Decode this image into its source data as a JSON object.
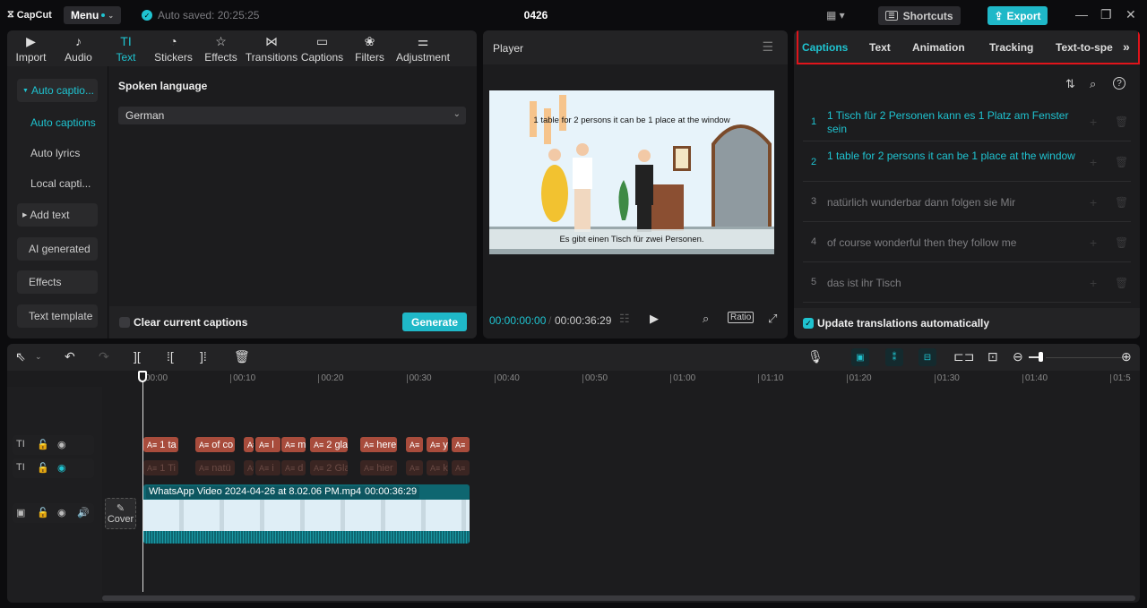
{
  "titlebar": {
    "app_name": "CapCut",
    "menu_label": "Menu",
    "autosave_text": "Auto saved: 20:25:25",
    "project_title": "0426",
    "shortcuts_label": "Shortcuts",
    "export_label": "Export",
    "icons": {
      "layout": "layout-icon",
      "minimize": "minimize-icon",
      "maximize": "restore-icon",
      "close": "close-icon"
    }
  },
  "media_toolbar": [
    {
      "label": "Import",
      "icon": "▶"
    },
    {
      "label": "Audio",
      "icon": "♪"
    },
    {
      "label": "Text",
      "icon": "TI",
      "active": true
    },
    {
      "label": "Stickers",
      "icon": "◔"
    },
    {
      "label": "Effects",
      "icon": "☆"
    },
    {
      "label": "Transitions",
      "icon": "⋈"
    },
    {
      "label": "Captions",
      "icon": "▭"
    },
    {
      "label": "Filters",
      "icon": "❀"
    },
    {
      "label": "Adjustment",
      "icon": "⚌"
    }
  ],
  "text_sidebar": {
    "items": [
      {
        "label": "Auto captio...",
        "expanded": true
      },
      {
        "label": "Auto captions",
        "active": true
      },
      {
        "label": "Auto lyrics"
      },
      {
        "label": "Local capti..."
      },
      {
        "label": "Add text"
      },
      {
        "label": "AI generated"
      },
      {
        "label": "Effects"
      },
      {
        "label": "Text template"
      }
    ]
  },
  "auto_captions": {
    "spoken_language_label": "Spoken language",
    "language_value": "German",
    "clear_captions_label": "Clear current captions",
    "clear_captions_checked": false,
    "generate_label": "Generate"
  },
  "player": {
    "title": "Player",
    "video_top_caption": "1 table for 2 persons it can be 1 place at the window",
    "video_bottom_caption": "Es gibt einen Tisch für zwei Personen.",
    "current_time": "00:00:00:00",
    "total_time": "00:00:36:29",
    "ratio_label": "Ratio"
  },
  "right_panel": {
    "tabs": [
      {
        "label": "Captions",
        "active": true
      },
      {
        "label": "Text"
      },
      {
        "label": "Animation"
      },
      {
        "label": "Tracking"
      },
      {
        "label": "Text-to-spe"
      }
    ],
    "captions": [
      {
        "num": "1",
        "text": "1 Tisch für 2 Personen kann es 1 Platz am Fenster sein",
        "highlighted": true
      },
      {
        "num": "2",
        "text": "1 table for 2 persons it can be 1 place at the window",
        "highlighted": true
      },
      {
        "num": "3",
        "text": "natürlich wunderbar dann folgen sie Mir",
        "highlighted": false
      },
      {
        "num": "4",
        "text": "of course wonderful then they follow me",
        "highlighted": false
      },
      {
        "num": "5",
        "text": "das ist ihr Tisch",
        "highlighted": false
      }
    ],
    "update_translations_label": "Update translations automatically",
    "update_translations_checked": true
  },
  "timeline": {
    "ruler_labels": [
      "00:00",
      "00:10",
      "00:20",
      "00:30",
      "00:40",
      "00:50",
      "01:00",
      "01:10",
      "01:20",
      "01:30",
      "01:40",
      "01:5"
    ],
    "caption_track_1": [
      "1 ta",
      "of co",
      "",
      "l",
      "m",
      "2 gla",
      "here",
      "",
      "y",
      ""
    ],
    "caption_track_2": [
      "1 Ti",
      "natü",
      "",
      "i",
      "d",
      "2 Gla",
      "hier",
      "",
      "k",
      ""
    ],
    "video_clip_name": "WhatsApp Video 2024-04-26 at 8.02.06 PM.mp4",
    "video_clip_duration": "00:00:36:29",
    "cover_label": "Cover",
    "zoom_level": 0.15
  },
  "colors": {
    "accent": "#1fc3d0",
    "caption_clip": "#a84c3c",
    "video_clip": "#0e6670",
    "highlight_border": "#e0141b"
  }
}
